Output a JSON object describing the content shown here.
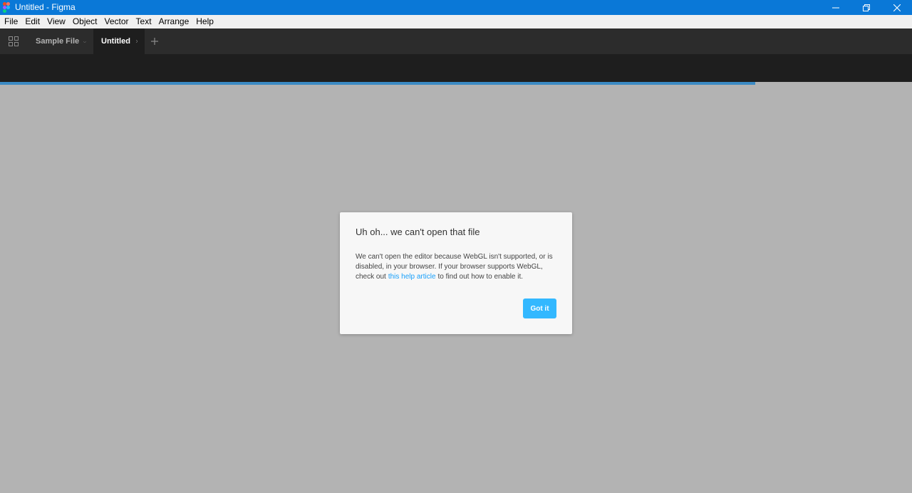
{
  "window": {
    "title": "Untitled - Figma",
    "app_icon": "figma-logo-icon",
    "controls": [
      "minimize-icon",
      "restore-icon",
      "close-icon"
    ]
  },
  "menu": {
    "items": [
      "File",
      "Edit",
      "View",
      "Object",
      "Vector",
      "Text",
      "Arrange",
      "Help"
    ]
  },
  "tabs": {
    "grid_icon": "grid-icon",
    "items": [
      {
        "label": "Sample File",
        "state": "loading",
        "active": false
      },
      {
        "label": "Untitled",
        "state": "loading",
        "active": true
      }
    ],
    "new_tab_icon": "plus-icon"
  },
  "progress": {
    "fraction": 0.828,
    "color": "#3b8ac4"
  },
  "modal": {
    "title": "Uh oh... we can't open that file",
    "body_before": "We can't open the editor because WebGL isn't supported, or is disabled, in your browser. If your browser supports WebGL, check out",
    "link_text": "this help article",
    "body_after": "to find out how to enable it.",
    "button_label": "Got it"
  },
  "colors": {
    "titlebar": "#0a78d7",
    "accent_button": "#33b8ff",
    "link": "#18a0fb",
    "canvas_overlay": "#b3b3b3"
  }
}
